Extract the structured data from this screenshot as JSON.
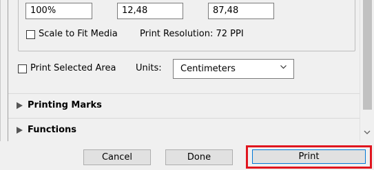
{
  "scale": {
    "percent_value": "100%",
    "height_value": "12,48",
    "width_value": "87,48",
    "fit_label": "Scale to Fit Media",
    "resolution_label": "Print Resolution: 72 PPI"
  },
  "print_selected_area_label": "Print Selected Area",
  "units": {
    "label": "Units:",
    "selected": "Centimeters"
  },
  "sections": {
    "printing_marks": "Printing Marks",
    "functions": "Functions"
  },
  "buttons": {
    "cancel": "Cancel",
    "done": "Done",
    "print": "Print"
  },
  "colors": {
    "highlight_box": "#e0151e",
    "focus_border": "#0078d7"
  },
  "icons": {
    "section_expand": "triangle-right-icon",
    "dropdown": "chevron-down-icon",
    "scroll_down": "chevron-down-icon"
  }
}
